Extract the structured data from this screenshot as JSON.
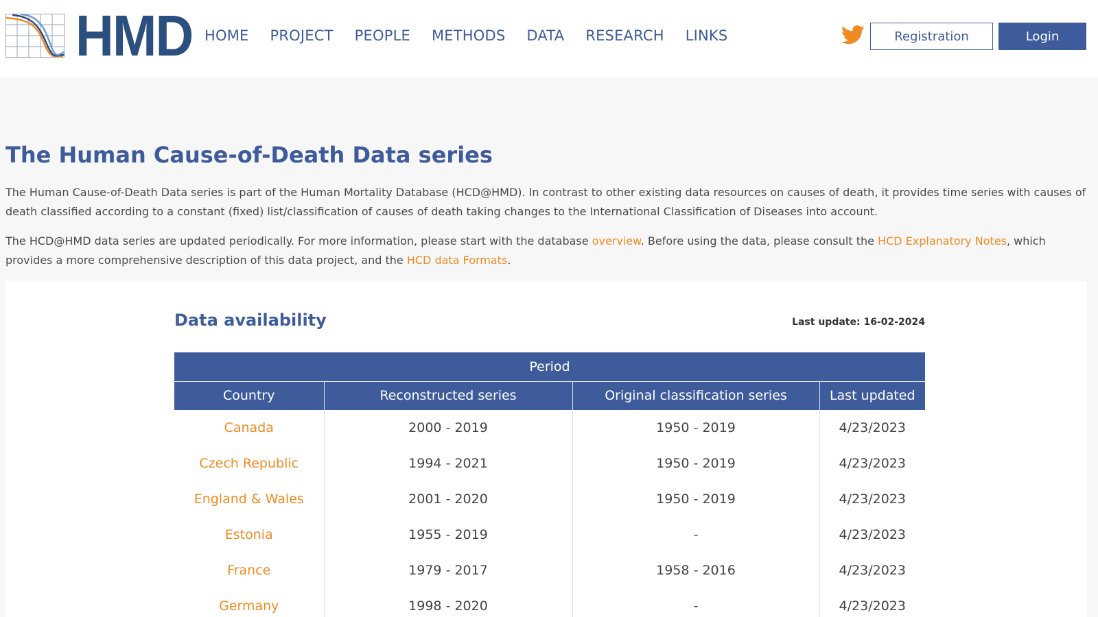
{
  "site": {
    "logo_text": "HMD"
  },
  "nav": {
    "items": [
      "HOME",
      "PROJECT",
      "PEOPLE",
      "METHODS",
      "DATA",
      "RESEARCH",
      "LINKS"
    ]
  },
  "header": {
    "registration_label": "Registration",
    "login_label": "Login"
  },
  "page": {
    "title": "The Human Cause-of-Death Data series",
    "intro_1": "The Human Cause-of-Death Data series is part of the Human Mortality Database (HCD@HMD). In contrast to other existing data resources on causes of death, it provides time series with causes of death classified according to a constant (fixed) list/classification of causes of death taking changes to the International Classification of Diseases into account.",
    "intro_2_a": "The HCD@HMD data series are updated periodically. For more information, please start with the database ",
    "link_overview": "overview",
    "intro_2_b": ". Before using the data, please consult the ",
    "link_notes": "HCD Explanatory Notes",
    "intro_2_c": ", which provides a more comprehensive description of this data project, and the ",
    "link_formats": "HCD data Formats",
    "intro_2_d": "."
  },
  "availability": {
    "title": "Data availability",
    "last_update": "Last update: 16-02-2024",
    "group_header": "Period",
    "columns": [
      "Country",
      "Reconstructed series",
      "Original classification series",
      "Last updated"
    ],
    "rows": [
      [
        "Canada",
        "2000 - 2019",
        "1950 - 2019",
        "4/23/2023"
      ],
      [
        "Czech Republic",
        "1994 - 2021",
        "1950 - 2019",
        "4/23/2023"
      ],
      [
        "England & Wales",
        "2001 - 2020",
        "1950 - 2019",
        "4/23/2023"
      ],
      [
        "Estonia",
        "1955 - 2019",
        "-",
        "4/23/2023"
      ],
      [
        "France",
        "1979 - 2017",
        "1958 - 2016",
        "4/23/2023"
      ],
      [
        "Germany",
        "1998 - 2020",
        "-",
        "4/23/2023"
      ]
    ]
  },
  "colors": {
    "brand_blue": "#3e5c9c",
    "logo_blue": "#2b4f7e",
    "link_orange": "#f18a22",
    "twitter_orange": "#f18a22"
  },
  "icons": {
    "logo": "hmd-logo-graph",
    "social": "twitter-icon"
  }
}
